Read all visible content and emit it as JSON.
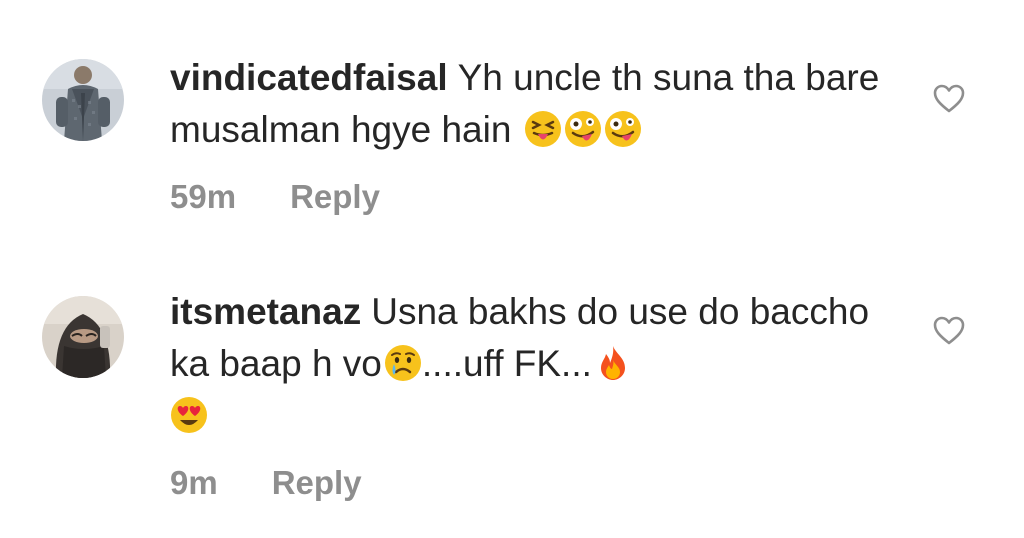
{
  "comments": [
    {
      "username": "vindicatedfaisal",
      "text": "Yh uncle th suna tha bare musalman hgye hain",
      "emojis": [
        "squinting-tongue-emoji",
        "zany-face-emoji",
        "zany-face-emoji"
      ],
      "time": "59m",
      "reply_label": "Reply",
      "avatar": "avatar-man-grey-suit"
    },
    {
      "username": "itsmetanaz",
      "text_part1": "Usna bakhs do use do baccho ka baap h vo",
      "text_part2": "....uff FK...",
      "emojis": [
        "crying-face-emoji",
        "fire-emoji",
        "heart-eyes-emoji"
      ],
      "time": "9m",
      "reply_label": "Reply",
      "avatar": "avatar-veiled-woman"
    }
  ],
  "icons": {
    "like": "heart-outline-icon"
  },
  "colors": {
    "text": "#262626",
    "muted": "#8e8e8e",
    "background": "#ffffff"
  }
}
